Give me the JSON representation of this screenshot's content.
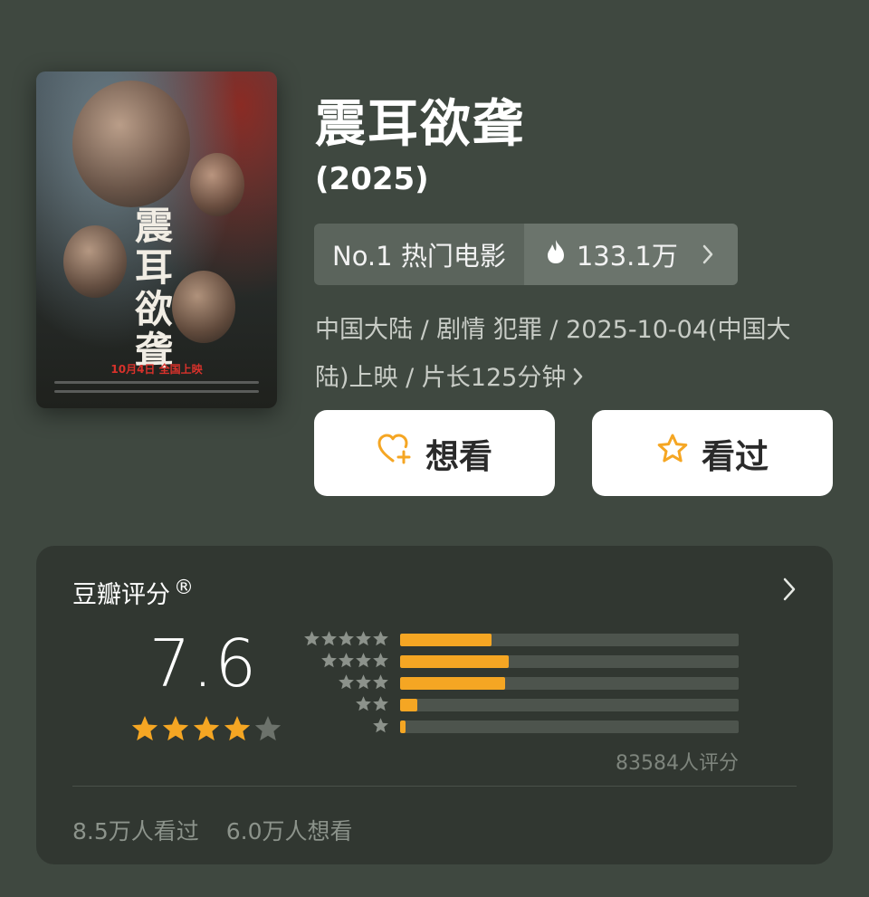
{
  "movie": {
    "title": "震耳欲聋",
    "year": "(2025)",
    "poster": {
      "title_text": "震耳欲聋",
      "release_text": "10月4日 全国上映"
    },
    "rank": {
      "label": "No.1 热门电影",
      "heat_value": "133.1万",
      "heat_icon": "flame-icon"
    },
    "meta_text": "中国大陆 / 剧情 犯罪 / 2025-10-04(中国大陆)上映 / 片长125分钟"
  },
  "actions": {
    "want_label": "想看",
    "seen_label": "看过",
    "want_icon": "heart-plus-icon",
    "seen_icon": "star-outline-icon"
  },
  "rating": {
    "header": "豆瓣评分",
    "registered_mark": "®",
    "score": "7.6",
    "score_stars": 4,
    "rating_count_text": "83584人评分",
    "distribution": [
      {
        "stars": 5,
        "fraction": 0.27
      },
      {
        "stars": 4,
        "fraction": 0.32
      },
      {
        "stars": 3,
        "fraction": 0.31
      },
      {
        "stars": 2,
        "fraction": 0.05
      },
      {
        "stars": 1,
        "fraction": 0.015
      }
    ],
    "seen_text": "8.5万人看过",
    "want_text": "6.0万人想看"
  },
  "colors": {
    "background": "#3f4840",
    "accent": "#f5a623",
    "card": "#313731"
  }
}
